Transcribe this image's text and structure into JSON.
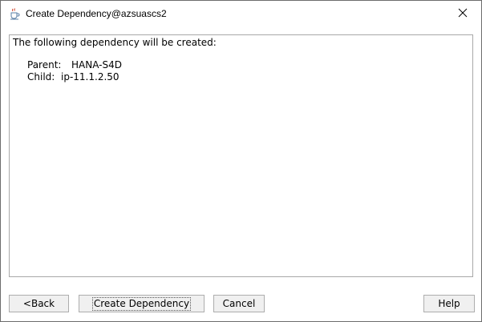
{
  "window": {
    "title": "Create Dependency@azsuascs2",
    "app_icon": "java-cup-icon",
    "close_icon": "close-icon"
  },
  "content": {
    "heading": "The following dependency will be created:",
    "parent_label": "Parent:",
    "parent_value": "HANA-S4D",
    "child_label": "Child:",
    "child_value": "ip-11.1.2.50"
  },
  "buttons": {
    "back": "<Back",
    "create": "Create Dependency",
    "cancel": "Cancel",
    "help": "Help"
  },
  "colors": {
    "window_border": "#6d6d6d",
    "panel_border": "#a8a8a8",
    "button_face": "#f0f0f0",
    "button_border": "#adadad"
  }
}
